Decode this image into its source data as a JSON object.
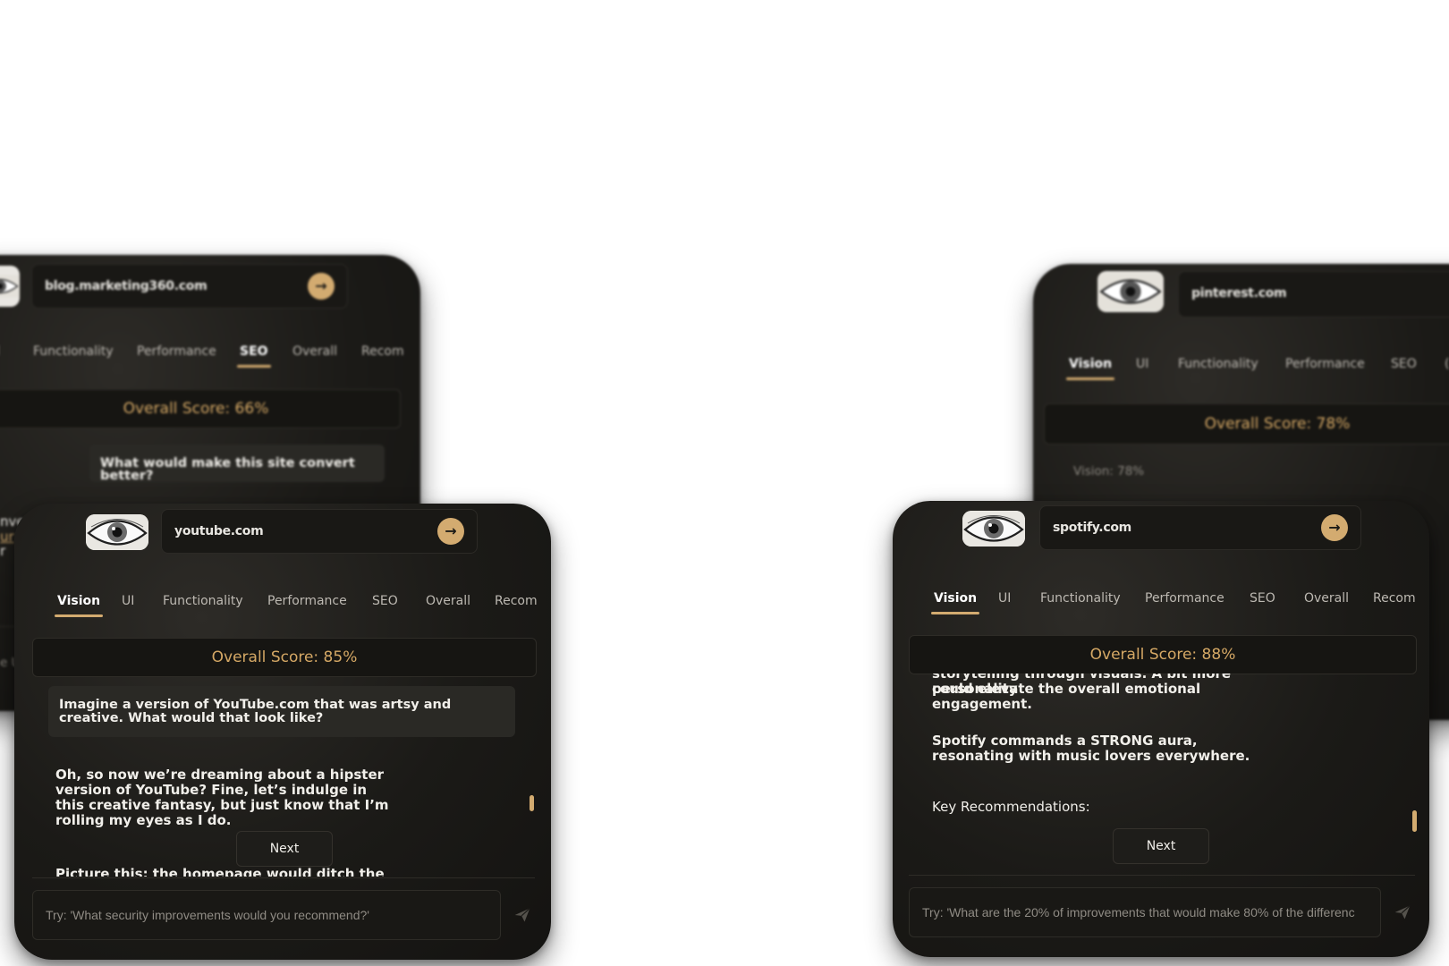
{
  "cards": {
    "back_left": {
      "url": "blog.marketing360.com",
      "tabs": [
        "l",
        "Functionality",
        "Performance",
        "SEO",
        "Overall",
        "Recom"
      ],
      "active_tab": "SEO",
      "score": "Overall Score: 66%",
      "user_message": "What would make this site convert better?",
      "edge_fragments": [
        "nve",
        "ur",
        "r",
        "e U"
      ]
    },
    "front_left": {
      "url": "youtube.com",
      "tabs": [
        "Vision",
        "UI",
        "Functionality",
        "Performance",
        "SEO",
        "Overall",
        "Recom"
      ],
      "active_tab": "Vision",
      "score": "Overall Score: 85%",
      "user_message": "Imagine a version of YouTube.com that was artsy and creative. What would that look like?",
      "assistant_message": "Oh, so now we’re dreaming about a hipster version of YouTube? Fine, let’s indulge in this creative fantasy, but just know that I’m rolling my eyes as I do.",
      "assistant_cut_line": "Picture this: the homepage would ditch the sterile",
      "next_label": "Next",
      "input_placeholder": "Try: 'What security improvements would you recommend?'"
    },
    "back_right": {
      "url": "pinterest.com",
      "tabs": [
        "Vision",
        "UI",
        "Functionality",
        "Performance",
        "SEO",
        "("
      ],
      "active_tab": "Vision",
      "score": "Overall Score: 78%",
      "vision_line": "Vision: 78%"
    },
    "front_right": {
      "url": "spotify.com",
      "tabs": [
        "Vision",
        "UI",
        "Functionality",
        "Performance",
        "SEO",
        "Overall",
        "Recom"
      ],
      "active_tab": "Vision",
      "score": "Overall Score: 88%",
      "text_cut_top": "storytelling through visuals. A bit more personality",
      "text_line2": "could elevate the overall emotional engagement.",
      "bold_statement": "Spotify commands a STRONG aura, resonating with music lovers everywhere.",
      "key_recs": "Key Recommendations:",
      "next_label": "Next",
      "input_placeholder": "Try: 'What are the 20% of improvements that would make 80% of the differenc"
    }
  },
  "colors": {
    "accent": "#d3ab70",
    "score_text": "#d5a865",
    "card_bg": "#1b1a17"
  },
  "icons": {
    "logo": "eye-icon",
    "go": "arrow-right-icon",
    "send": "paper-plane-icon"
  }
}
